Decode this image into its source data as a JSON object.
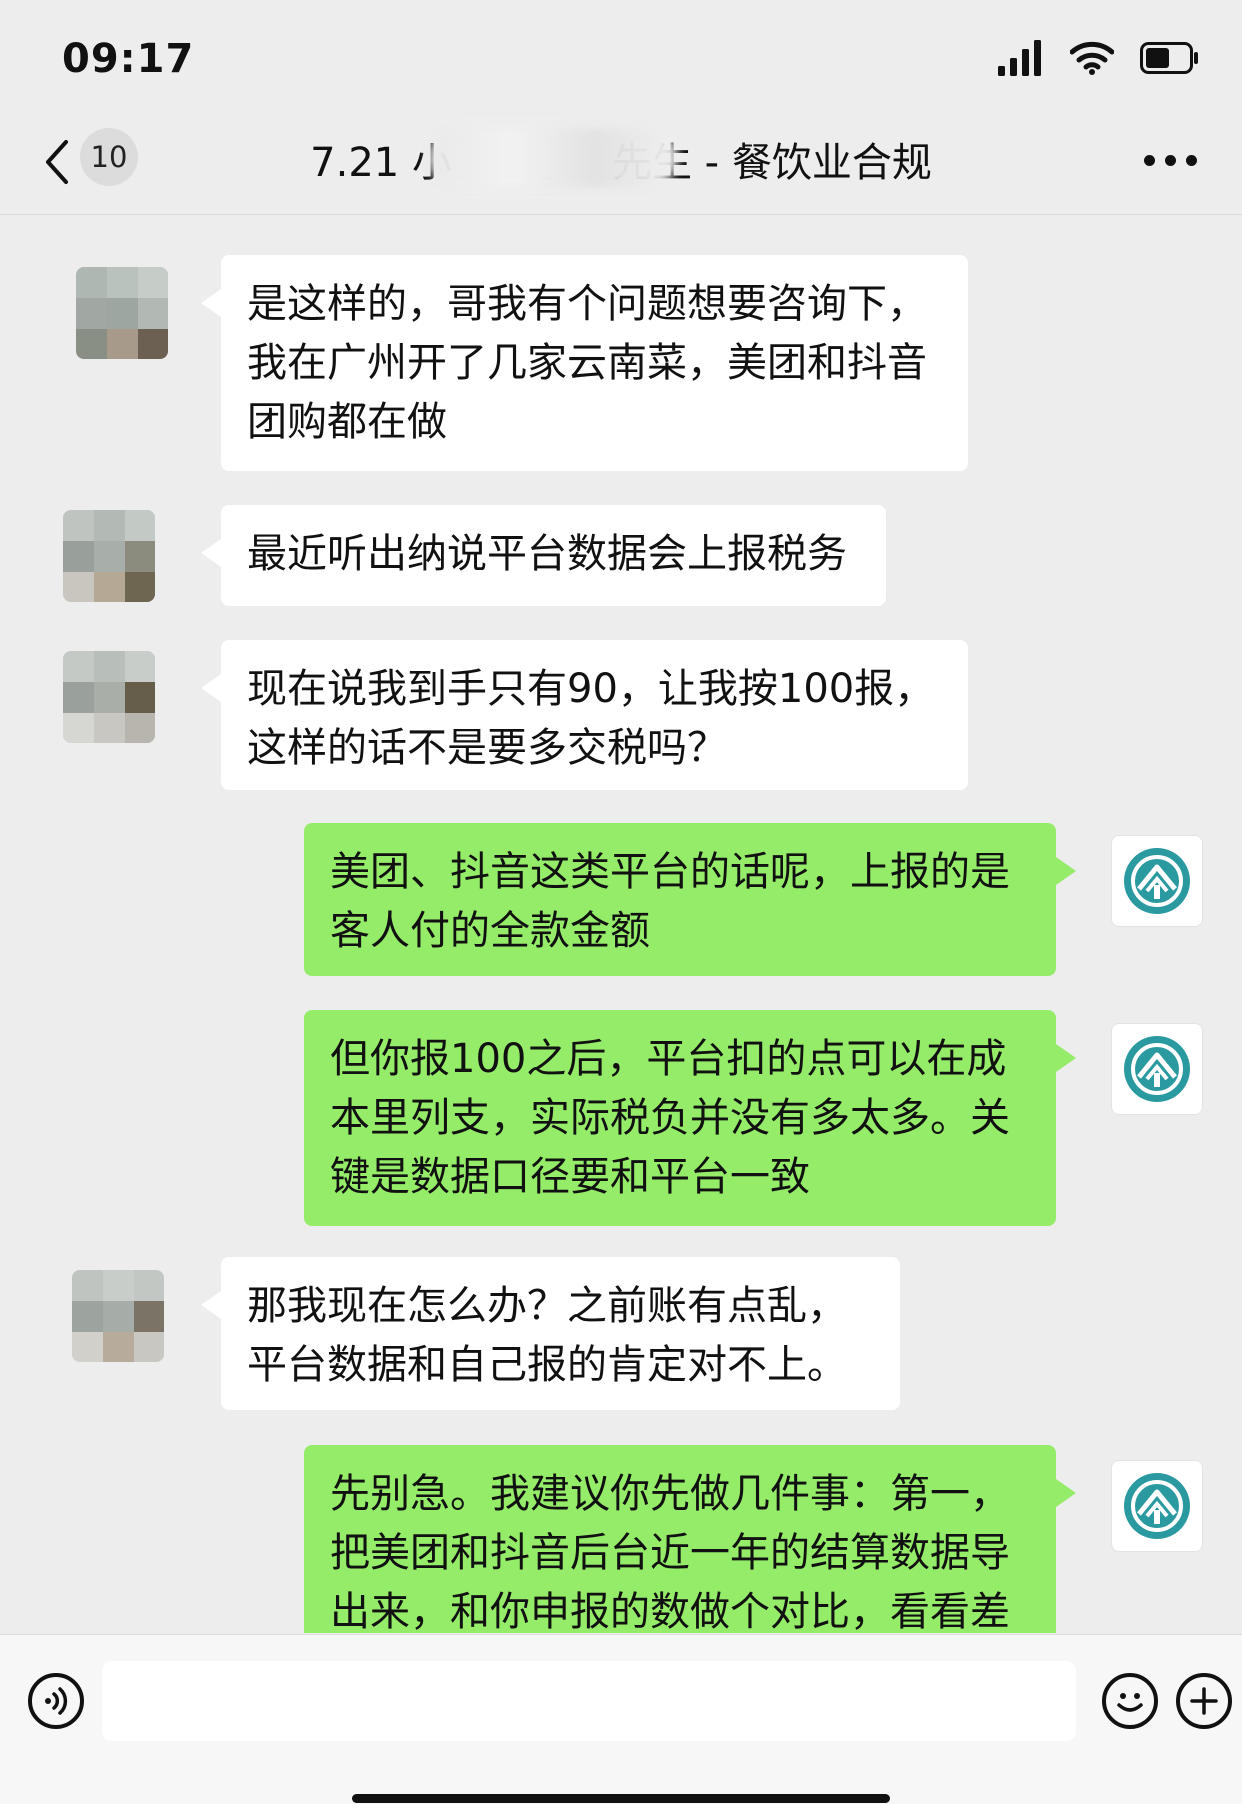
{
  "status_bar": {
    "time": "09:17",
    "battery_level": 0.55
  },
  "nav": {
    "unread_count": "10",
    "title_prefix": "7.21 小",
    "title_suffix": "先生 - 餐饮业合规"
  },
  "messages": [
    {
      "side": "in",
      "text": "是这样的，哥我有个问题想要咨询下，我在广州开了几家云南菜，美团和抖音团购都在做"
    },
    {
      "side": "in",
      "text": "最近听出纳说平台数据会上报税务"
    },
    {
      "side": "in",
      "text": "现在说我到手只有90，让我按100报，这样的话不是要多交税吗？"
    },
    {
      "side": "out",
      "text": "美团、抖音这类平台的话呢，上报的是客人付的全款金额"
    },
    {
      "side": "out",
      "text": "但你报100之后，平台扣的点可以在成本里列支，实际税负并没有多太多。关键是数据口径要和平台一致"
    },
    {
      "side": "in",
      "text": "那我现在怎么办？之前账有点乱，平台数据和自己报的肯定对不上。"
    },
    {
      "side": "out",
      "text": "先别急。我建议你先做几件事：第一，把美团和抖音后台近一年的结算数据导出来，和你申报的数做个对比，看看差"
    }
  ],
  "input": {
    "placeholder": ""
  },
  "colors": {
    "outgoing_bubble": "#95ec69",
    "incoming_bubble": "#ffffff",
    "background": "#ededed",
    "logo_teal": "#2a9aa0"
  },
  "icons": [
    "back-chevron-icon",
    "more-icon",
    "voice-icon",
    "emoji-icon",
    "plus-icon",
    "signal-icon",
    "wifi-icon",
    "battery-icon"
  ]
}
